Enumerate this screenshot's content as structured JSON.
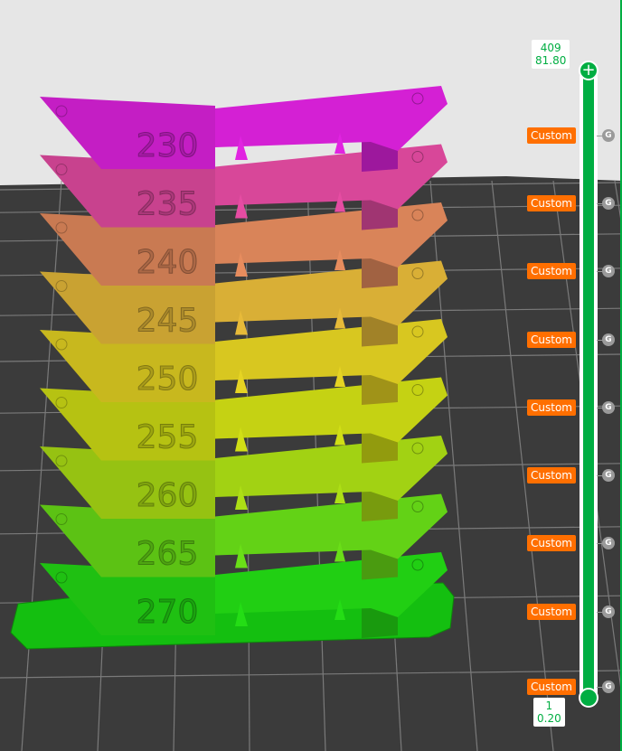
{
  "tower": {
    "tiers": [
      {
        "label": "230",
        "color": "#c41ec4"
      },
      {
        "label": "235",
        "color": "#c8428e"
      },
      {
        "label": "240",
        "color": "#c97a52"
      },
      {
        "label": "245",
        "color": "#c9a232"
      },
      {
        "label": "250",
        "color": "#c8b81e"
      },
      {
        "label": "255",
        "color": "#b6c212"
      },
      {
        "label": "260",
        "color": "#96c212"
      },
      {
        "label": "265",
        "color": "#5cc214"
      },
      {
        "label": "270",
        "color": "#1fc012"
      }
    ],
    "base_color": "#14bf10"
  },
  "slider": {
    "top_layer": "409",
    "top_height": "81.80",
    "bottom_layer": "1",
    "bottom_height": "0.20",
    "accent": "#00ae42",
    "top_icon": "plus-icon",
    "markers": [
      {
        "label": "Custom",
        "g": "G"
      },
      {
        "label": "Custom",
        "g": "G"
      },
      {
        "label": "Custom",
        "g": "G"
      },
      {
        "label": "Custom",
        "g": "G"
      },
      {
        "label": "Custom",
        "g": "G"
      },
      {
        "label": "Custom",
        "g": "G"
      },
      {
        "label": "Custom",
        "g": "G"
      },
      {
        "label": "Custom",
        "g": "G"
      },
      {
        "label": "Custom",
        "g": "G"
      }
    ]
  },
  "colors": {
    "bed": "#3b3b3b",
    "grid": "#8a8a8a",
    "background": "#e6e6e6",
    "marker": "#ff6f00"
  }
}
